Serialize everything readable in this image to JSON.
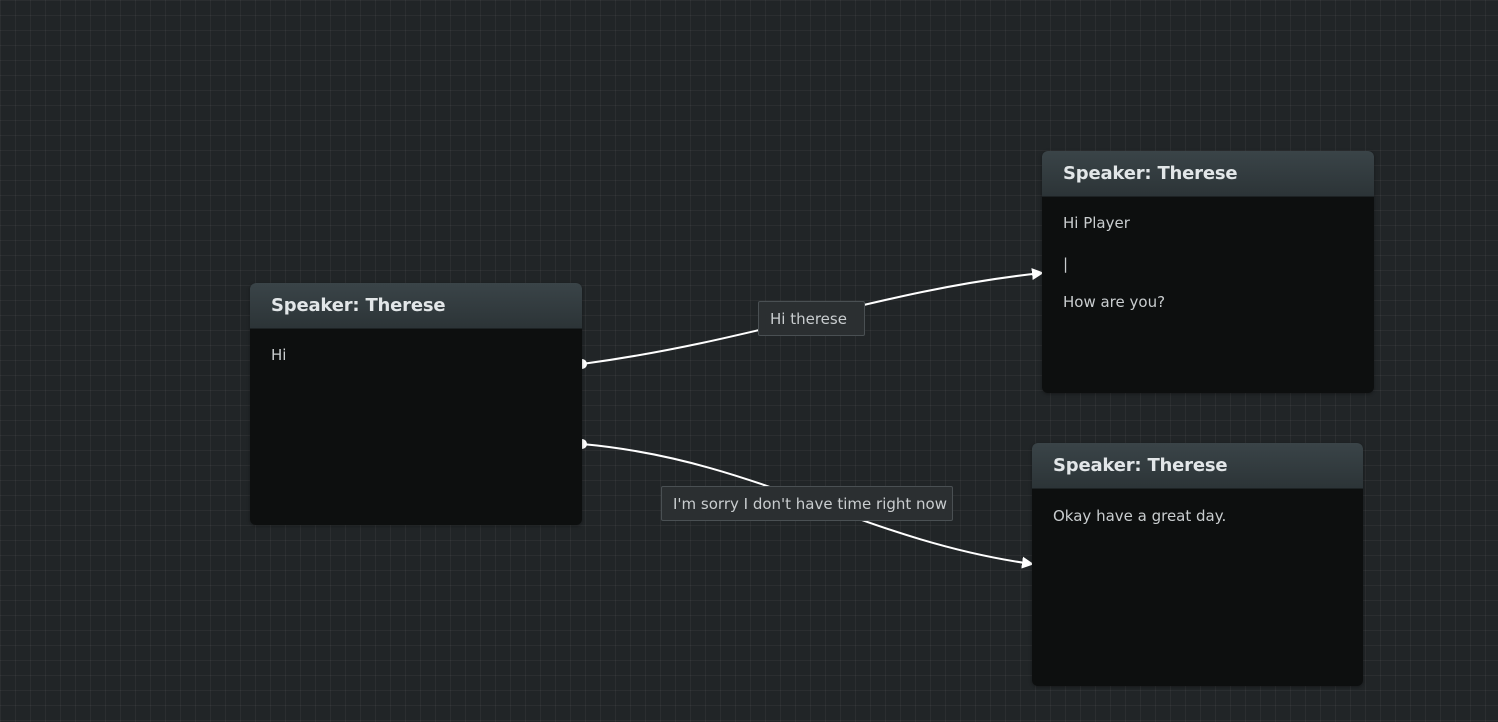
{
  "nodes": [
    {
      "title": "Speaker: Therese",
      "lines": [
        "Hi"
      ]
    },
    {
      "title": "Speaker: Therese",
      "lines": [
        "Hi Player",
        "|",
        "How are you?"
      ]
    },
    {
      "title": "Speaker: Therese",
      "lines": [
        "Okay have a great day."
      ]
    }
  ],
  "edges": [
    {
      "label": "Hi therese"
    },
    {
      "label": "I'm sorry I don't have time right now"
    }
  ],
  "colors": {
    "background": "#212527",
    "node_body": "#0d0f0f",
    "node_header": "#323b3e",
    "edge": "#ffffff"
  }
}
